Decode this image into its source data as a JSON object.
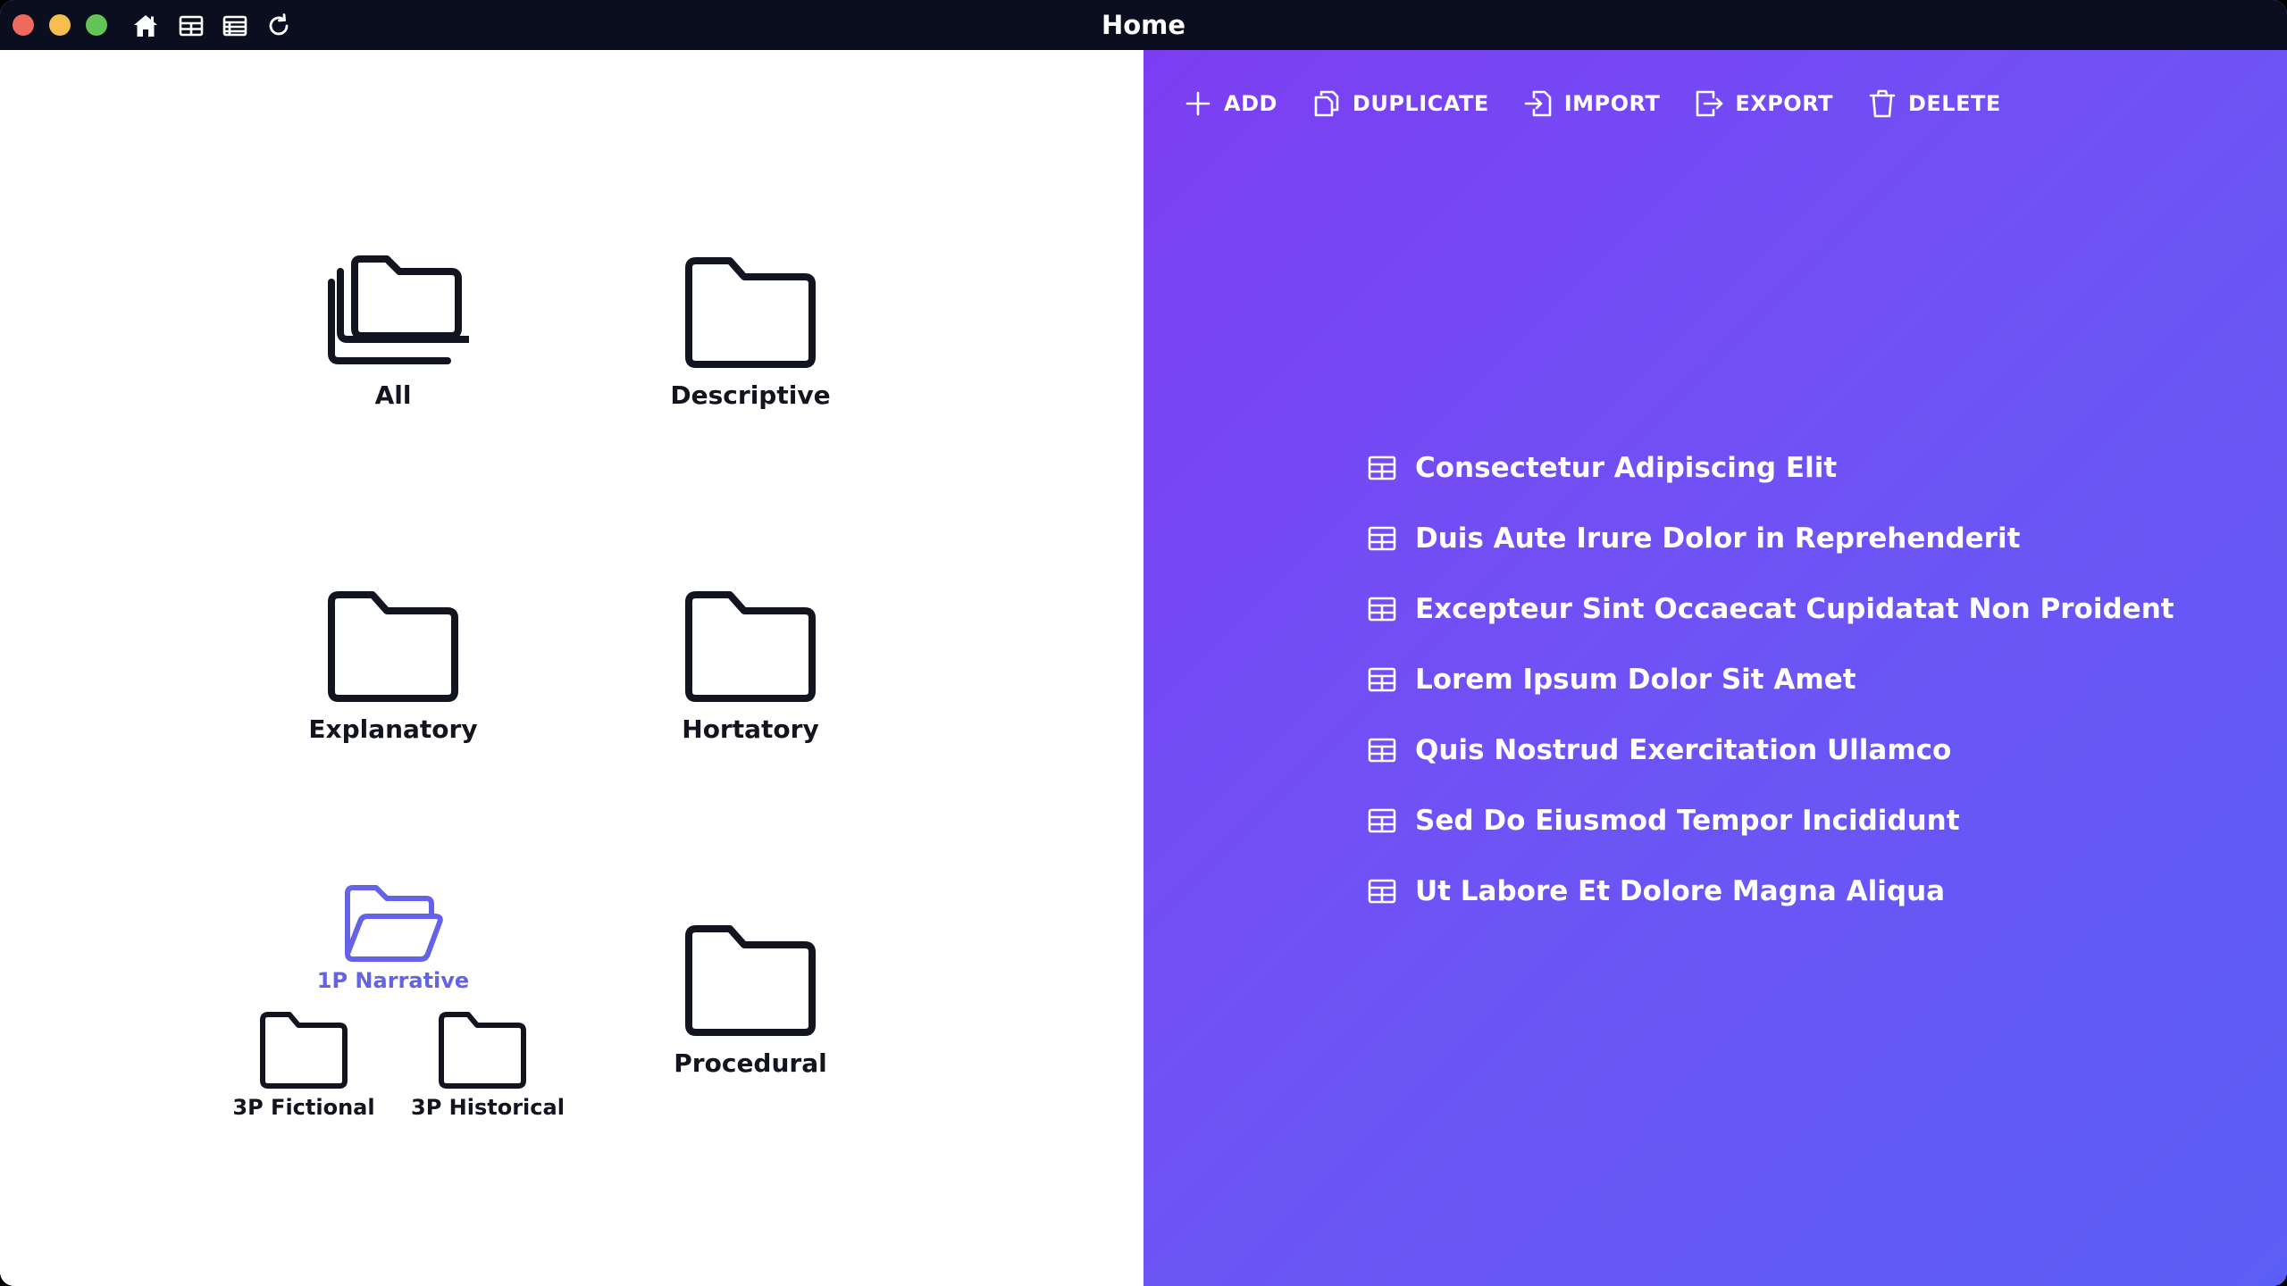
{
  "window": {
    "title": "Home"
  },
  "titlebar": {
    "icons": [
      "home-icon",
      "table-icon",
      "list-icon",
      "refresh-icon"
    ]
  },
  "folders": {
    "all": {
      "label": "All",
      "icon": "folders-stack-icon"
    },
    "descriptive": {
      "label": "Descriptive",
      "icon": "folder-icon"
    },
    "explanatory": {
      "label": "Explanatory",
      "icon": "folder-icon"
    },
    "hortatory": {
      "label": "Hortatory",
      "icon": "folder-icon"
    },
    "narrative": {
      "label": "1P Narrative",
      "icon": "folder-open-icon",
      "selected": true,
      "children": [
        {
          "label": "3P Fictional",
          "icon": "folder-icon"
        },
        {
          "label": "3P Historical",
          "icon": "folder-icon"
        }
      ]
    },
    "procedural": {
      "label": "Procedural",
      "icon": "folder-icon"
    }
  },
  "toolbar": {
    "add": "ADD",
    "duplicate": "DUPLICATE",
    "import": "IMPORT",
    "export": "EXPORT",
    "delete": "DELETE"
  },
  "items": [
    "Consectetur Adipiscing Elit",
    "Duis Aute Irure Dolor in Reprehenderit",
    "Excepteur Sint Occaecat Cupidatat Non Proident",
    "Lorem Ipsum Dolor Sit Amet",
    "Quis Nostrud Exercitation Ullamco",
    "Sed Do Eiusmod Tempor Incididunt",
    "Ut Labore Et Dolore Magna Aliqua"
  ],
  "colors": {
    "titlebar": "#0b0e1f",
    "accent_selected": "#6462e6",
    "gradient_start": "#7c3ef2",
    "gradient_end": "#5b5ef6",
    "folder_stroke": "#12141f"
  }
}
